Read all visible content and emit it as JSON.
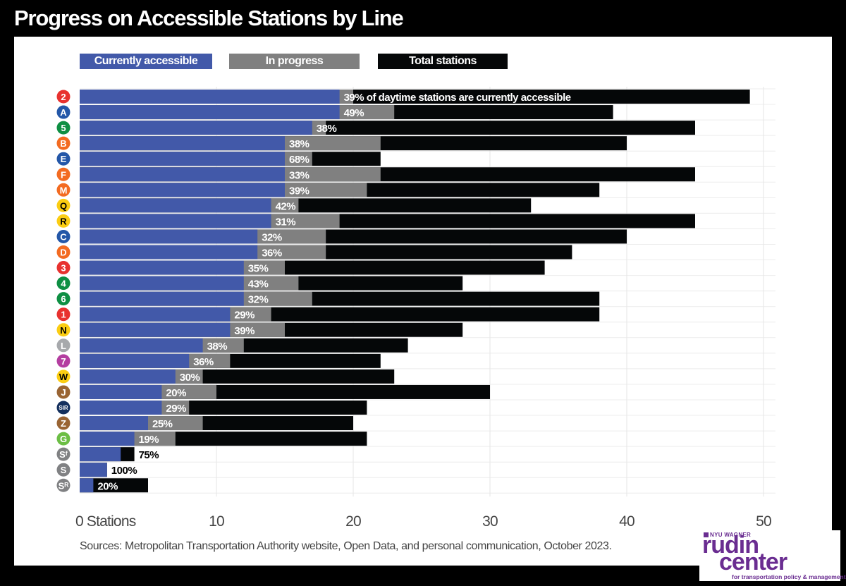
{
  "title": "Progress on Accessible Stations by Line",
  "legend": [
    {
      "label": "Currently accessible",
      "color": "#4259a9"
    },
    {
      "label": "In progress",
      "color": "#808080"
    },
    {
      "label": "Total stations",
      "color": "#050708"
    }
  ],
  "source": "Sources: Metropolitan Transportation Authority website, Open Data, and personal communication, October 2023.",
  "logo": {
    "org": "NYU WAGNER",
    "name_line1": "rudin",
    "name_line2": "center",
    "tagline": "for transportation policy & management"
  },
  "chart_data": {
    "type": "bar",
    "orientation": "horizontal",
    "stacked": "overlay",
    "title": "Progress on Accessible Stations by Line",
    "xlabel": "",
    "ylabel": "",
    "xlim": [
      0,
      50
    ],
    "xticks": [
      0,
      10,
      20,
      30,
      40,
      50
    ],
    "xtick_labels": [
      "0 Stations",
      "10",
      "20",
      "30",
      "40",
      "50"
    ],
    "grid": true,
    "legend_position": "top",
    "annotation": "39% of daytime stations are currently accessible",
    "categories": [
      {
        "line": "2",
        "color": "#e8322f",
        "text_color": "#ffffff"
      },
      {
        "line": "A",
        "color": "#2457a8",
        "text_color": "#ffffff"
      },
      {
        "line": "5",
        "color": "#0e8f43",
        "text_color": "#ffffff"
      },
      {
        "line": "B",
        "color": "#f36b21",
        "text_color": "#ffffff"
      },
      {
        "line": "E",
        "color": "#2457a8",
        "text_color": "#ffffff"
      },
      {
        "line": "F",
        "color": "#f36b21",
        "text_color": "#ffffff"
      },
      {
        "line": "M",
        "color": "#f36b21",
        "text_color": "#ffffff"
      },
      {
        "line": "Q",
        "color": "#fbcd13",
        "text_color": "#000000"
      },
      {
        "line": "R",
        "color": "#fbcd13",
        "text_color": "#000000"
      },
      {
        "line": "C",
        "color": "#2457a8",
        "text_color": "#ffffff"
      },
      {
        "line": "D",
        "color": "#f36b21",
        "text_color": "#ffffff"
      },
      {
        "line": "3",
        "color": "#e8322f",
        "text_color": "#ffffff"
      },
      {
        "line": "4",
        "color": "#0e8f43",
        "text_color": "#ffffff"
      },
      {
        "line": "6",
        "color": "#0e8f43",
        "text_color": "#ffffff"
      },
      {
        "line": "1",
        "color": "#e8322f",
        "text_color": "#ffffff"
      },
      {
        "line": "N",
        "color": "#fbcd13",
        "text_color": "#000000"
      },
      {
        "line": "L",
        "color": "#a7a9ac",
        "text_color": "#ffffff"
      },
      {
        "line": "7",
        "color": "#b43ea0",
        "text_color": "#ffffff"
      },
      {
        "line": "W",
        "color": "#fbcd13",
        "text_color": "#000000"
      },
      {
        "line": "J",
        "color": "#996433",
        "text_color": "#ffffff"
      },
      {
        "line": "SIR",
        "color": "#14305e",
        "text_color": "#ffffff"
      },
      {
        "line": "Z",
        "color": "#996433",
        "text_color": "#ffffff"
      },
      {
        "line": "G",
        "color": "#6cbe45",
        "text_color": "#ffffff"
      },
      {
        "line": "Sᶠ",
        "color": "#808183",
        "text_color": "#ffffff"
      },
      {
        "line": "S",
        "color": "#808183",
        "text_color": "#ffffff"
      },
      {
        "line": "Sᴿ",
        "color": "#808183",
        "text_color": "#ffffff"
      }
    ],
    "series": [
      {
        "name": "Currently accessible",
        "values": [
          19,
          19,
          17,
          15,
          15,
          15,
          15,
          14,
          14,
          13,
          13,
          12,
          12,
          12,
          11,
          11,
          9,
          8,
          7,
          6,
          6,
          5,
          4,
          3,
          2,
          1
        ]
      },
      {
        "name": "In progress (cumulative with accessible)",
        "values": [
          20,
          23,
          18,
          22,
          17,
          22,
          21,
          16,
          19,
          18,
          18,
          15,
          16,
          17,
          14,
          15,
          12,
          11,
          9,
          10,
          8,
          9,
          7,
          3,
          2,
          1
        ]
      },
      {
        "name": "Total stations",
        "values": [
          49,
          39,
          45,
          40,
          22,
          45,
          38,
          33,
          45,
          40,
          36,
          34,
          28,
          38,
          38,
          28,
          24,
          22,
          23,
          30,
          21,
          20,
          21,
          4,
          2,
          5
        ]
      }
    ],
    "data_labels": [
      "39%",
      "49%",
      "38%",
      "38%",
      "68%",
      "33%",
      "39%",
      "42%",
      "31%",
      "32%",
      "36%",
      "35%",
      "43%",
      "32%",
      "29%",
      "39%",
      "38%",
      "36%",
      "30%",
      "20%",
      "29%",
      "25%",
      "19%",
      "75%",
      "100%",
      "20%"
    ]
  }
}
